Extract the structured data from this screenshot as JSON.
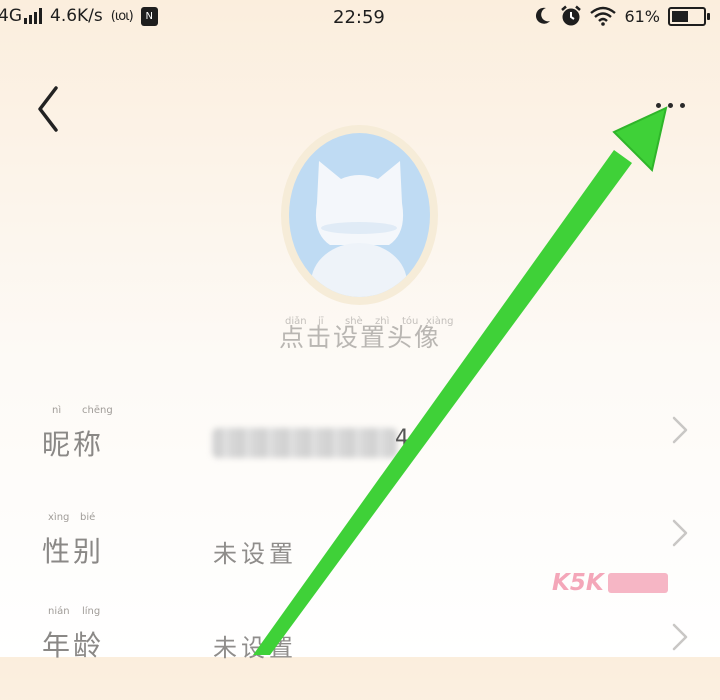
{
  "status_bar": {
    "network": "4G",
    "speed": "4.6K/s",
    "hotspot": "(ιοι)",
    "nfc": "N",
    "time": "22:59",
    "battery": "61%",
    "battery_level": 0.61
  },
  "avatar": {
    "caption": "点击设置头像",
    "caption_pinyin": [
      "diǎn",
      "jī",
      "shè",
      "zhì",
      "tóu",
      "xiàng"
    ]
  },
  "profile_rows": [
    {
      "label": "昵称",
      "label_pinyin": [
        "nì",
        "chēng"
      ],
      "value": ""
    },
    {
      "label": "性别",
      "label_pinyin": [
        "xìng",
        "bié"
      ],
      "value": "未设置"
    },
    {
      "label": "年龄",
      "label_pinyin": [
        "nián",
        "líng"
      ],
      "value": "未设置"
    }
  ],
  "nickname_suffix": "4",
  "watermark": {
    "text": "K5K"
  },
  "colors": {
    "arrow": "#3fd138",
    "avatar_bg": "#bfdbf3",
    "avatar_ring": "#f6ecd8"
  },
  "icons": [
    "signal-icon",
    "hotspot-icon",
    "nfc-icon",
    "moon-icon",
    "alarm-icon",
    "wifi-icon",
    "battery-icon",
    "back-chevron-icon",
    "more-dots-icon",
    "chevron-right-icon"
  ]
}
